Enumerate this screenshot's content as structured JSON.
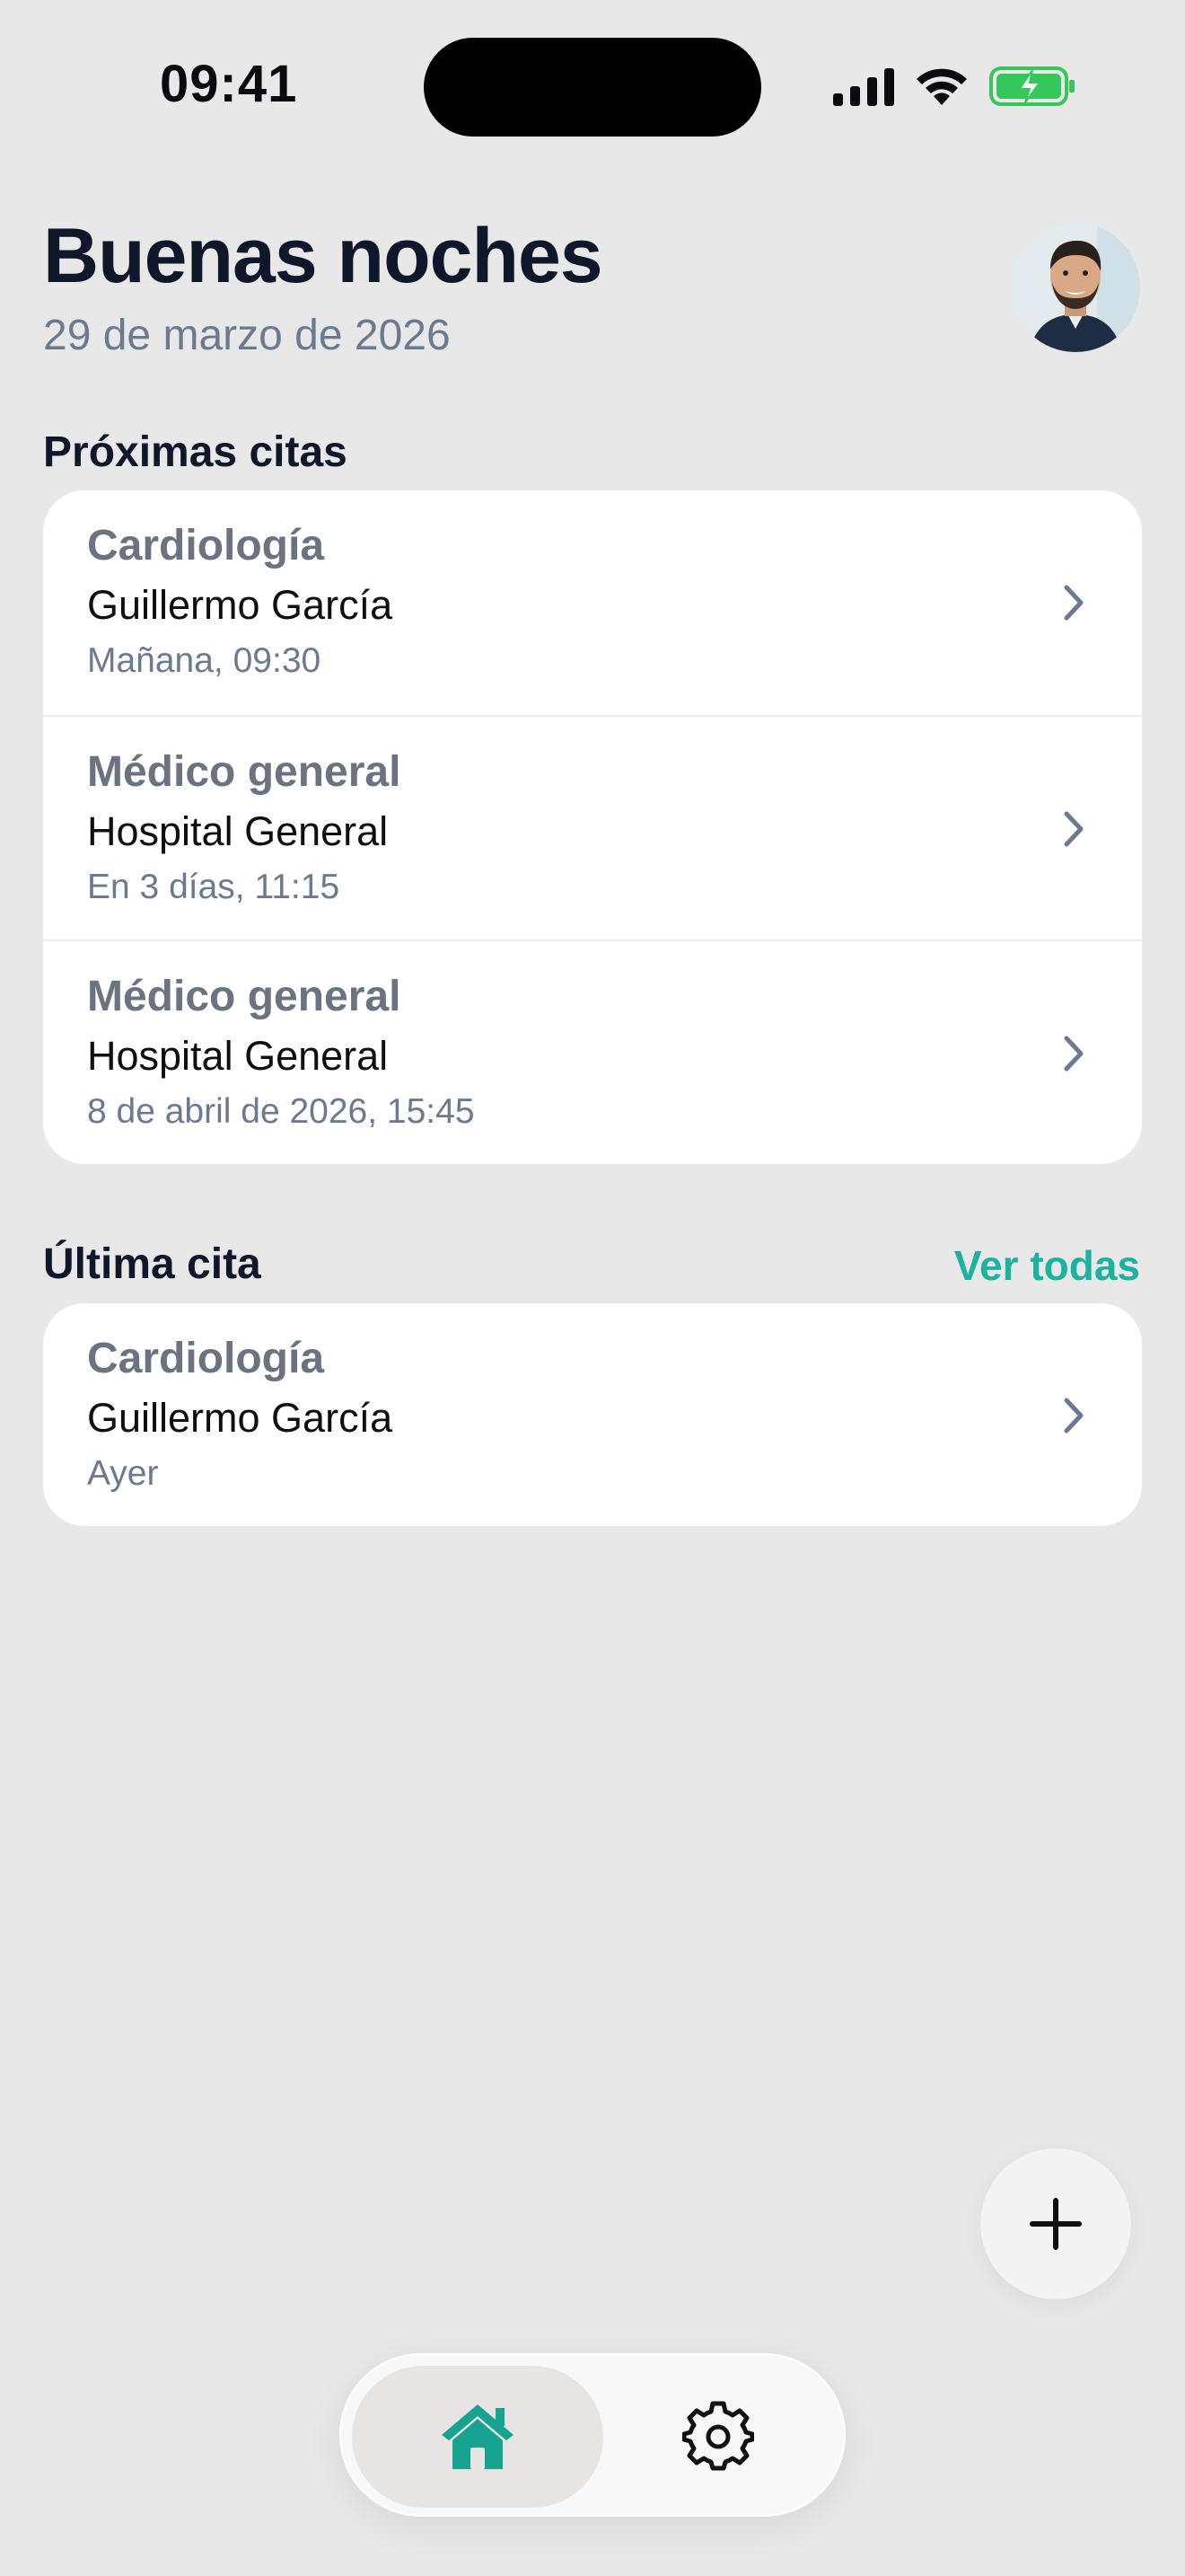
{
  "status_bar": {
    "time": "09:41"
  },
  "header": {
    "greeting": "Buenas noches",
    "date": "29 de marzo de 2026"
  },
  "upcoming": {
    "title": "Próximas citas",
    "items": [
      {
        "specialty": "Cardiología",
        "doctor": "Guillermo García",
        "when": "Mañana, 09:30"
      },
      {
        "specialty": "Médico general",
        "doctor": "Hospital General",
        "when": "En 3 días, 11:15"
      },
      {
        "specialty": "Médico general",
        "doctor": "Hospital General",
        "when": "8 de abril de 2026, 15:45"
      }
    ]
  },
  "last": {
    "title": "Última cita",
    "see_all": "Ver todas",
    "items": [
      {
        "specialty": "Cardiología",
        "doctor": "Guillermo García",
        "when": "Ayer"
      }
    ]
  },
  "colors": {
    "accent": "#1bb3a0",
    "home_icon": "#16a390",
    "battery": "#34c759",
    "background": "#e9e8e9"
  },
  "icons": {
    "fab": "plus-icon",
    "tab_home": "home-icon",
    "tab_settings": "gear-icon"
  }
}
